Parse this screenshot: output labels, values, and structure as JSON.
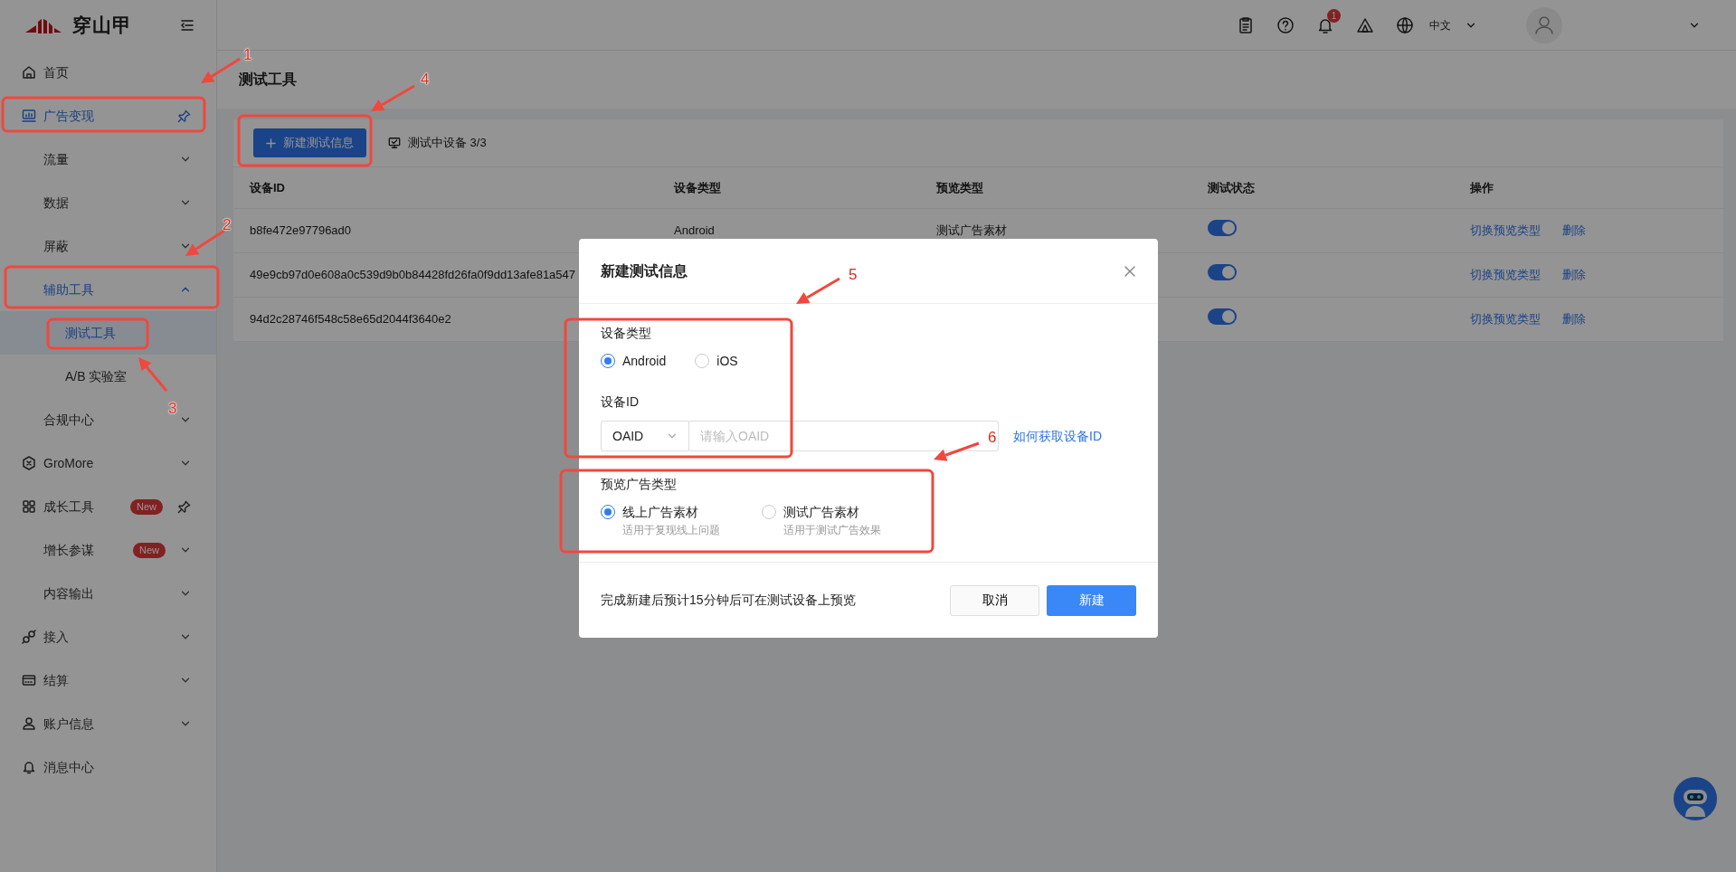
{
  "sidebar": {
    "logo_text": "穿山甲",
    "items": [
      {
        "label": "首页",
        "selected": false
      },
      {
        "label": "广告变现",
        "selected": false,
        "kind": "pin",
        "children": [
          {
            "label": "流量",
            "selected": false,
            "kind": "chevron",
            "expanded": false
          },
          {
            "label": "数据",
            "selected": false,
            "kind": "chevron",
            "expanded": false
          },
          {
            "label": "屏蔽",
            "selected": false,
            "kind": "chevron",
            "expanded": false
          },
          {
            "label": "辅助工具",
            "selected": false,
            "kind": "chevron",
            "expanded": true,
            "children": [
              {
                "label": "测试工具",
                "selected": true
              },
              {
                "label": "A/B 实验室",
                "selected": false
              }
            ]
          },
          {
            "label": "合规中心",
            "selected": false,
            "kind": "chevron",
            "expanded": false
          }
        ]
      },
      {
        "label": "GroMore",
        "selected": false,
        "kind": "chevron",
        "expanded": false
      },
      {
        "label": "成长工具",
        "selected": false,
        "kind": "pin",
        "badge": "New",
        "children": [
          {
            "label": "增长参谋",
            "selected": false,
            "kind": "chevron",
            "expanded": false,
            "badge": "New"
          },
          {
            "label": "内容输出",
            "selected": false,
            "kind": "chevron",
            "expanded": false
          }
        ]
      },
      {
        "label": "接入",
        "selected": false,
        "kind": "chevron",
        "expanded": false
      },
      {
        "label": "结算",
        "selected": false,
        "kind": "chevron",
        "expanded": false
      },
      {
        "label": "账户信息",
        "selected": false,
        "kind": "chevron",
        "expanded": false
      },
      {
        "label": "消息中心",
        "selected": false
      }
    ]
  },
  "topbar": {
    "notification_count": "1",
    "language": "中文"
  },
  "page": {
    "title": "测试工具"
  },
  "toolbar": {
    "new_button": "新建测试信息",
    "devices_count": "测试中设备 3/3"
  },
  "table": {
    "columns": [
      "设备ID",
      "设备类型",
      "预览类型",
      "测试状态",
      "操作"
    ],
    "rows": [
      {
        "cells": [
          "b8fe472e97796ad0",
          "Android",
          "测试广告素材"
        ],
        "on": true,
        "actions": [
          "切换预览类型",
          "删除"
        ]
      },
      {
        "cells": [
          "49e9cb97d0e608a0c539d9b0b84428fd26fa0f9dd13afe81a547"
        ],
        "on": true,
        "actions": [
          "切换预览类型",
          "删除"
        ]
      },
      {
        "cells": [
          "94d2c28746f548c58e65d2044f3640e2"
        ],
        "on": true,
        "actions": [
          "切换预览类型",
          "删除"
        ]
      }
    ]
  },
  "modal": {
    "title": "新建测试信息",
    "device_type": {
      "label": "设备类型",
      "options": [
        {
          "label": "Android",
          "selected": true
        },
        {
          "label": "iOS",
          "selected": false
        }
      ]
    },
    "device_id": {
      "label": "设备ID",
      "id_type": "OAID",
      "placeholder": "请输入OAID",
      "help_link": "如何获取设备ID"
    },
    "preview_type": {
      "label": "预览广告类型",
      "options": [
        {
          "label": "线上广告素材",
          "hint": "适用于复现线上问题",
          "selected": true
        },
        {
          "label": "测试广告素材",
          "hint": "适用于测试广告效果",
          "selected": false
        }
      ]
    },
    "footer_note": "完成新建后预计15分钟后可在测试设备上预览",
    "buttons": {
      "cancel": "取消",
      "confirm": "新建"
    }
  },
  "annotations": [
    {
      "number": "1"
    },
    {
      "number": "2"
    },
    {
      "number": "3"
    },
    {
      "number": "4"
    },
    {
      "number": "5"
    },
    {
      "number": "6"
    }
  ]
}
